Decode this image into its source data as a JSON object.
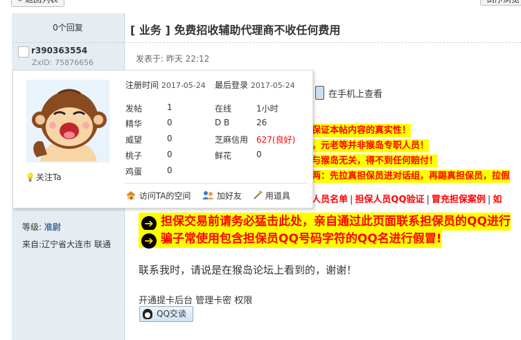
{
  "nav": {
    "back_label": "« 返回列表",
    "right_label": "倒序浏览"
  },
  "post": {
    "reply_count": "0个回复",
    "title": "[ 业务 ] 免费招收辅助代理商不收任何费用",
    "posted_label": "发表于: 昨天 22:12",
    "mobile_view": "在手机上查看"
  },
  "author": {
    "username": "r390363554",
    "zxid": "ZxID:  75876656",
    "level_label": "等级:",
    "level_value": "准尉",
    "location": "来自:辽宁省大连市 联通"
  },
  "card": {
    "follow": "关注Ta",
    "reg_label": "注册时间",
    "reg_date": "2017-05-24",
    "last_label": "最后登录",
    "last_date": "2017-05-24",
    "stats_left": [
      {
        "label": "发帖",
        "value": "1"
      },
      {
        "label": "精华",
        "value": "0"
      },
      {
        "label": "威望",
        "value": "0"
      },
      {
        "label": "桃子",
        "value": "0"
      },
      {
        "label": "鸡蛋",
        "value": "0"
      }
    ],
    "stats_right": [
      {
        "label": "在线",
        "value": "1小时"
      },
      {
        "label": "D B",
        "value": "26"
      },
      {
        "label": "芝麻信用",
        "value": "627(良好)"
      },
      {
        "label": "鲜花",
        "value": "0"
      }
    ],
    "actions": {
      "space": "访问TA的空间",
      "add_friend": "加好友",
      "tools": "用道具"
    }
  },
  "notices": {
    "line1": "保证本帖内容的真实性！",
    "line2": "。元老等并非猴岛专职人员！",
    "line3": "与猴岛无关，得不到任何赔付！",
    "line4": "两：先拉真担保员进对话组，再踢真担保员，拉假",
    "links": [
      "人员名单",
      "担保人员QQ验证",
      "冒充担保案例",
      "如"
    ],
    "big1": "担保交易前请务必猛击此处，亲自通过此页面联系担保员的QQ进行",
    "big2": "骗子常使用包含担保员QQ号码字符的QQ名进行假冒!"
  },
  "content": {
    "contact": "联系我时，请说是在猴岛论坛上看到的，谢谢！",
    "service": "开通提卡后台 管理卡密 权限",
    "qq_button": "QQ交谈"
  },
  "colors": {
    "sidebar": "#e5edf2",
    "alert": "#ff0000",
    "highlight": "#ffff00"
  }
}
